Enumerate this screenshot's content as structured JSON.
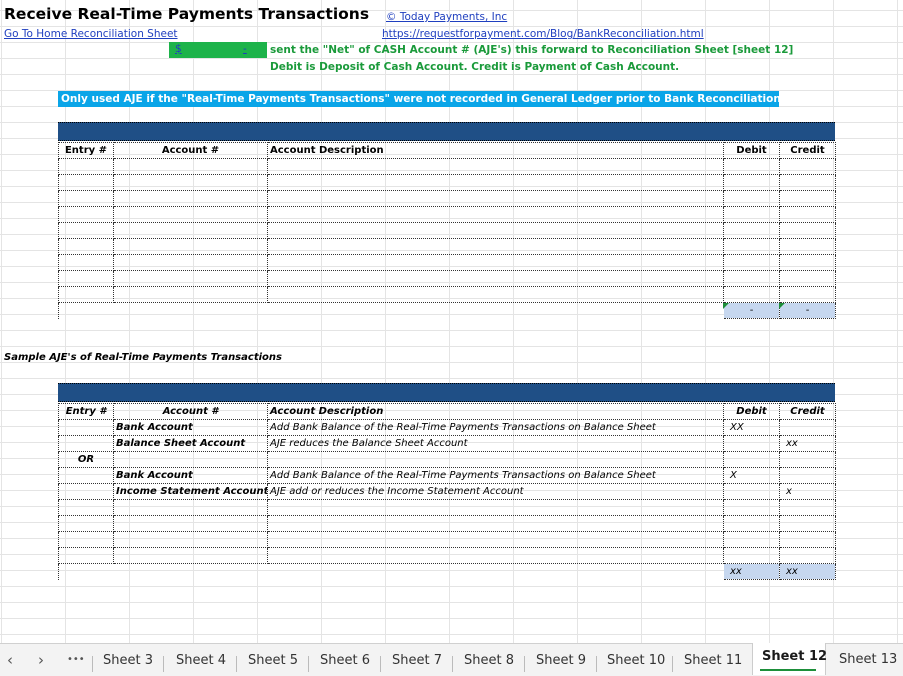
{
  "header": {
    "title": "Receive Real-Time Payments Transactions",
    "home_link": "Go To Home Reconciliation Sheet",
    "copyright_link": "© Today Payments, Inc",
    "url_link": "https://requestforpayment.com/Blog/BankReconciliation.html",
    "dollar_sign": "$",
    "dash": "-",
    "note_line1": "sent the \"Net\" of CASH Account # (AJE's) this forward to Reconciliation Sheet [sheet 12]",
    "note_line2": "Debit is Deposit of Cash Account.  Credit is Payment of Cash Account.",
    "banner": "Only used AJE if the \"Real-Time Payments Transactions\" were not recorded in General Ledger prior to Bank Reconciliation sheet."
  },
  "table1": {
    "headers": [
      "Entry #",
      "Account #",
      "Account Description",
      "Debit",
      "Credit"
    ],
    "total_debit": "-",
    "total_credit": "-"
  },
  "sample": {
    "heading": "Sample AJE's of Real-Time Payments Transactions",
    "headers": [
      "Entry #",
      "Account #",
      "Account Description",
      "Debit",
      "Credit"
    ],
    "rows": [
      {
        "entry": "",
        "account": "Bank Account",
        "desc": "Add Bank Balance of the Real-Time Payments Transactions on Balance Sheet",
        "debit": "XX",
        "credit": ""
      },
      {
        "entry": "",
        "account": "Balance Sheet Account",
        "desc": "AJE reduces the Balance Sheet Account",
        "debit": "",
        "credit": "xx"
      },
      {
        "entry": "OR",
        "account": "",
        "desc": "",
        "debit": "",
        "credit": ""
      },
      {
        "entry": "",
        "account": "Bank Account",
        "desc": "Add Bank Balance of the Real-Time Payments Transactions on Balance Sheet",
        "debit": "X",
        "credit": ""
      },
      {
        "entry": "",
        "account": "Income Statement Account",
        "desc": "AJE add or reduces the Income Statement Account",
        "debit": "",
        "credit": "x"
      }
    ],
    "total_debit": "xx",
    "total_credit": "xx"
  },
  "tabs": {
    "prev": "‹",
    "next": "›",
    "more": "•••",
    "items": [
      "Sheet 3",
      "Sheet 4",
      "Sheet 5",
      "Sheet 6",
      "Sheet 7",
      "Sheet 8",
      "Sheet 9",
      "Sheet 10",
      "Sheet 11",
      "Sheet 12",
      "Sheet 13"
    ],
    "active": "Sheet 12"
  }
}
